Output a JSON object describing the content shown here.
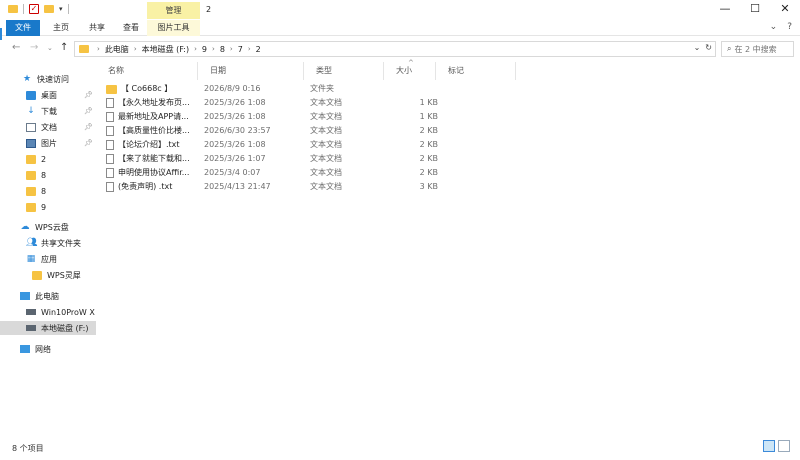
{
  "window": {
    "title": "2",
    "manage_tab": "管理",
    "controls": {
      "minimize": "—",
      "maximize": "☐",
      "close": "✕"
    }
  },
  "ribbon": {
    "tabs": [
      "文件",
      "主页",
      "共享",
      "查看",
      "图片工具"
    ],
    "expand_icon": "⌄",
    "help_icon": "?"
  },
  "address": {
    "crumbs": [
      "此电脑",
      "本地磁盘 (F:)",
      "9",
      "8",
      "7",
      "2"
    ],
    "dropdown_icon": "⌄",
    "refresh_icon": "↻"
  },
  "search": {
    "placeholder": "在 2 中搜索"
  },
  "sidebar": {
    "quick_access": "快速访问",
    "quick_items": [
      "桌面",
      "下载",
      "文档",
      "图片",
      "2",
      "8",
      "8",
      "9"
    ],
    "wps_cloud": "WPS云盘",
    "wps_items": [
      "共享文件夹",
      "应用",
      "WPS灵犀"
    ],
    "this_pc": "此电脑",
    "pc_items": [
      "Win10ProW X",
      "本地磁盘 (F:)"
    ],
    "network": "网络"
  },
  "columns": {
    "name": "名称",
    "date": "日期",
    "type": "类型",
    "size": "大小",
    "tags": "标记"
  },
  "files": [
    {
      "name": "【 Co668c 】",
      "date": "2026/8/9 0:16",
      "type": "文件夹",
      "size": "",
      "kind": "folder"
    },
    {
      "name": "【永久地址发布页...",
      "date": "2025/3/26 1:08",
      "type": "文本文档",
      "size": "1 KB",
      "kind": "file"
    },
    {
      "name": "最新地址及APP请...",
      "date": "2025/3/26 1:08",
      "type": "文本文档",
      "size": "1 KB",
      "kind": "file"
    },
    {
      "name": "【高质量性价比楼...",
      "date": "2026/6/30 23:57",
      "type": "文本文档",
      "size": "2 KB",
      "kind": "file"
    },
    {
      "name": "【论坛介绍】.txt",
      "date": "2025/3/26 1:08",
      "type": "文本文档",
      "size": "2 KB",
      "kind": "file"
    },
    {
      "name": "【来了就能下载和...",
      "date": "2025/3/26 1:07",
      "type": "文本文档",
      "size": "2 KB",
      "kind": "file"
    },
    {
      "name": "申明使用协议Affir...",
      "date": "2025/3/4 0:07",
      "type": "文本文档",
      "size": "2 KB",
      "kind": "file"
    },
    {
      "name": "(免责声明) .txt",
      "date": "2025/4/13 21:47",
      "type": "文本文档",
      "size": "3 KB",
      "kind": "file"
    }
  ],
  "status": {
    "count": "8 个项目"
  }
}
